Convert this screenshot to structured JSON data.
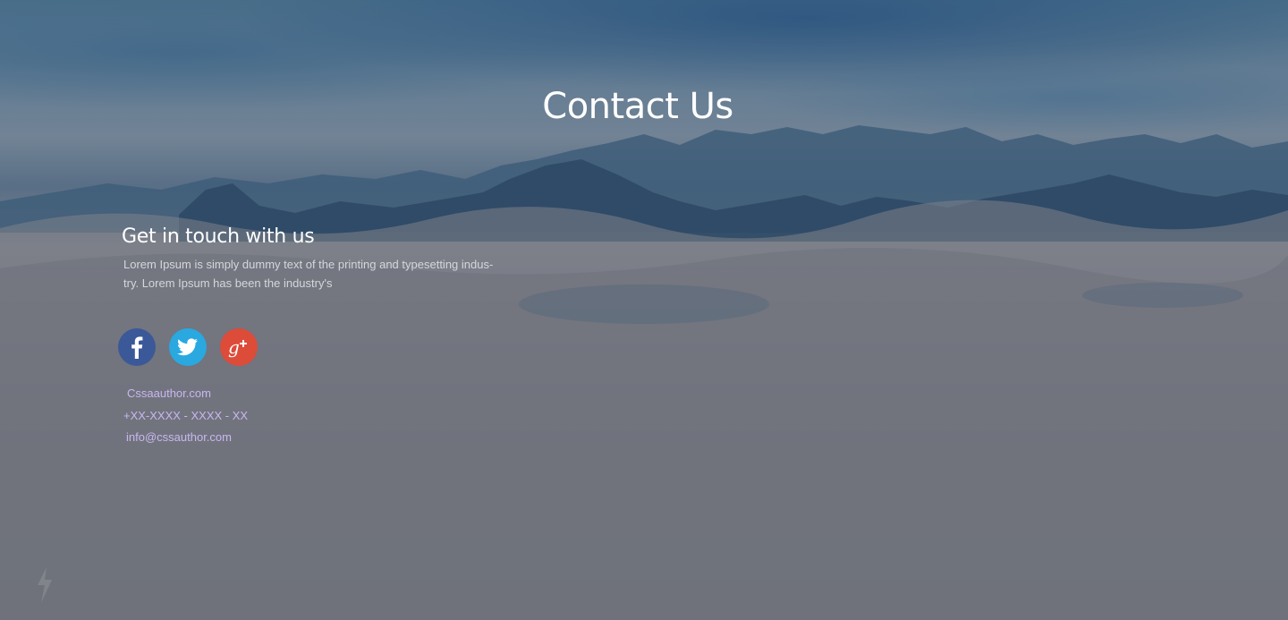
{
  "page": {
    "title": "Contact Us"
  },
  "contact": {
    "heading": "Get in touch with us",
    "description": "Lorem Ipsum is simply dummy text of the printing and typesetting indus- try. Lorem Ipsum has been the industry's",
    "social": [
      {
        "name": "facebook",
        "icon": "facebook-icon",
        "color": "#3b5998"
      },
      {
        "name": "twitter",
        "icon": "twitter-icon",
        "color": "#2aa8e0"
      },
      {
        "name": "google-plus",
        "icon": "google-plus-icon",
        "color": "#dd4b39"
      }
    ],
    "website": "Cssaauthor.com",
    "phone": "+XX-XXXX - XXXX - XX",
    "email": "info@cssauthor.com"
  },
  "colors": {
    "link": "#c9b6f2",
    "heading": "#ffffff",
    "text": "#d6d6dc"
  }
}
